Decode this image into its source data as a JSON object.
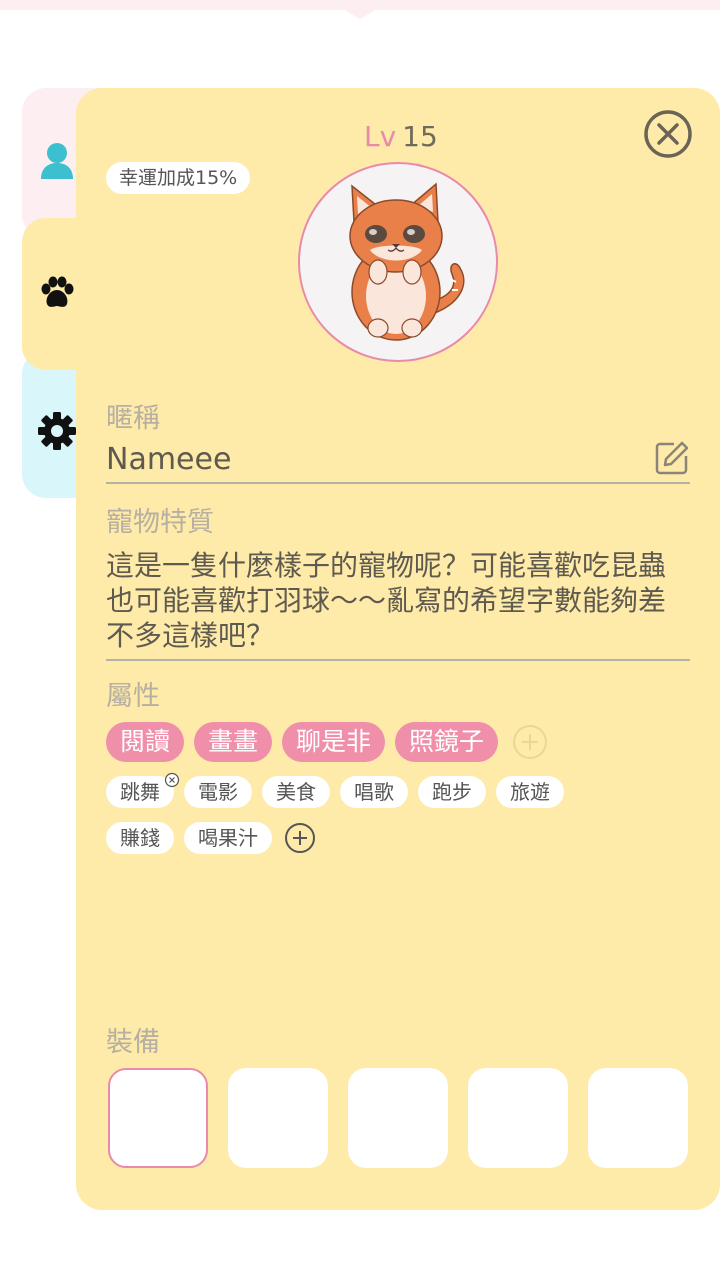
{
  "tabs": [
    {
      "name": "profile",
      "icon": "person-icon",
      "color": "#3cbfce"
    },
    {
      "name": "pet",
      "icon": "paw-icon",
      "color": "#111111",
      "active": true
    },
    {
      "name": "settings",
      "icon": "gear-icon",
      "color": "#111111"
    }
  ],
  "pet": {
    "level_prefix": "Lv",
    "level_value": "15",
    "luck_badge": "幸運加成15%",
    "nickname_label": "暱稱",
    "nickname_value": "Nameee",
    "trait_label": "寵物特質",
    "trait_text": "這是一隻什麼樣子的寵物呢？可能喜歡吃昆蟲也可能喜歡打羽球～～亂寫的希望字數能夠差不多這樣吧？",
    "attributes_label": "屬性",
    "primary_tags": [
      "閱讀",
      "畫畫",
      "聊是非",
      "照鏡子"
    ],
    "secondary_tags_row1": [
      "跳舞",
      "電影",
      "美食",
      "唱歌",
      "跑步",
      "旅遊"
    ],
    "secondary_tags_row2": [
      "賺錢",
      "喝果汁"
    ],
    "equipment_label": "裝備",
    "equipment_slots": 5,
    "selected_slot": 1
  },
  "colors": {
    "panel": "#feeaa9",
    "accent_pink": "#ef8faa",
    "text": "#5f5a50",
    "muted": "#b7b0a2"
  }
}
